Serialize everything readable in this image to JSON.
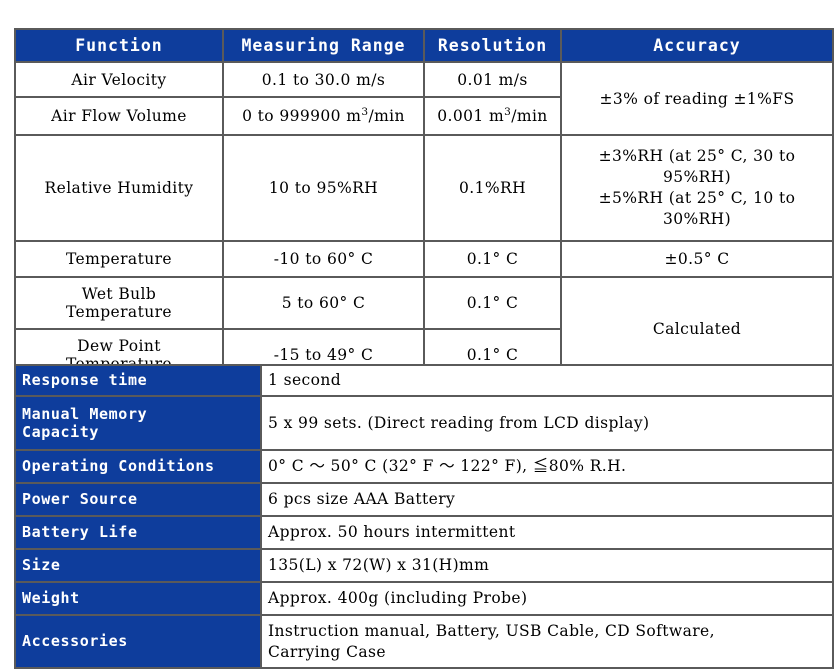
{
  "measurement_table": {
    "headers": [
      "Function",
      "Measuring Range",
      "Resolution",
      "Accuracy"
    ],
    "rows": {
      "air_velocity": {
        "function": "Air Velocity",
        "range": "0.1 to 30.0 m/s",
        "resolution": "0.01 m/s"
      },
      "air_flow_volume": {
        "function": "Air Flow Volume",
        "range_prefix": "0 to 999900 m",
        "range_exponent": "3",
        "range_suffix": "/min",
        "resolution_prefix": "0.001 m",
        "resolution_exponent": "3",
        "resolution_suffix": "/min"
      },
      "velocity_flow_accuracy": "±3% of reading ±1%FS",
      "relative_humidity": {
        "function": "Relative Humidity",
        "range": "10 to 95%RH",
        "resolution": "0.1%RH",
        "accuracy_line1": "±3%RH (at 25° C, 30 to",
        "accuracy_line2": "95%RH)",
        "accuracy_line3": "±5%RH (at 25° C, 10 to",
        "accuracy_line4": "30%RH)"
      },
      "temperature": {
        "function": "Temperature",
        "range": "-10 to 60° C",
        "resolution": "0.1° C",
        "accuracy": "±0.5° C"
      },
      "wet_bulb_temperature": {
        "function_line1": "Wet Bulb",
        "function_line2": "Temperature",
        "range": "5 to 60° C",
        "resolution": "0.1° C"
      },
      "dew_point_temperature": {
        "function_line1": "Dew Point",
        "function_line2": "Temperature",
        "range": "-15 to 49° C",
        "resolution": "0.1° C"
      },
      "calculated_accuracy": "Calculated"
    }
  },
  "general_table": {
    "rows": [
      {
        "label": "Response time",
        "value": "1 second"
      },
      {
        "label_line1": "Manual Memory",
        "label_line2": "Capacity",
        "value": "5 x 99 sets. (Direct reading from LCD display)"
      },
      {
        "label": "Operating Conditions",
        "value": "0° C ～ 50° C (32° F ～ 122° F), ≦80% R.H."
      },
      {
        "label": "Power Source",
        "value": "6 pcs size AAA Battery"
      },
      {
        "label": "Battery Life",
        "value": "Approx. 50 hours intermittent"
      },
      {
        "label": "Size",
        "value": "135(L) x 72(W) x 31(H)mm"
      },
      {
        "label": "Weight",
        "value": "Approx. 400g (including Probe)"
      },
      {
        "label": "Accessories",
        "value_line1": "Instruction manual, Battery, USB Cable, CD Software,",
        "value_line2": "Carrying Case"
      }
    ]
  },
  "colors": {
    "header_blue": "#0e3d9c",
    "border_gray": "#5a5a5a",
    "text_black": "#000000",
    "header_text": "#ffffff"
  }
}
